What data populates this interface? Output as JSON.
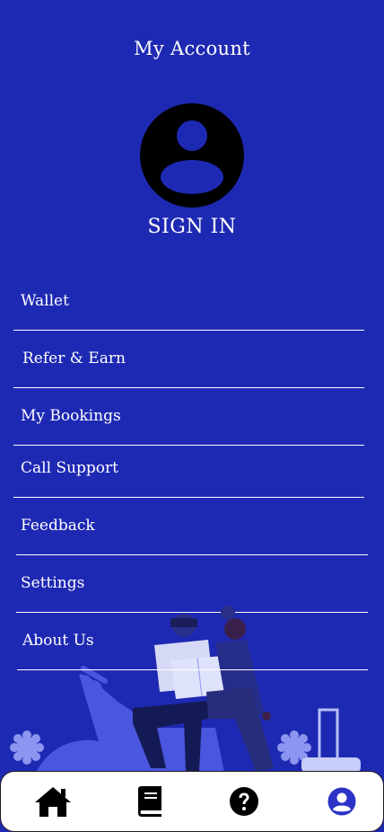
{
  "header": {
    "title": "My Account"
  },
  "profile": {
    "sign_in_label": "SIGN IN"
  },
  "menu": {
    "items": [
      {
        "label": "Wallet"
      },
      {
        "label": "Refer & Earn"
      },
      {
        "label": "My Bookings"
      },
      {
        "label": "Call Support"
      },
      {
        "label": "Feedback"
      },
      {
        "label": "Settings"
      },
      {
        "label": "About Us"
      }
    ]
  },
  "bottom_nav": {
    "items": [
      {
        "icon": "home-icon"
      },
      {
        "icon": "book-icon"
      },
      {
        "icon": "help-icon"
      },
      {
        "icon": "account-icon",
        "active": true
      }
    ]
  },
  "colors": {
    "background": "#1e29b3",
    "active_nav": "#2c33c6",
    "inactive_nav": "#000000"
  }
}
